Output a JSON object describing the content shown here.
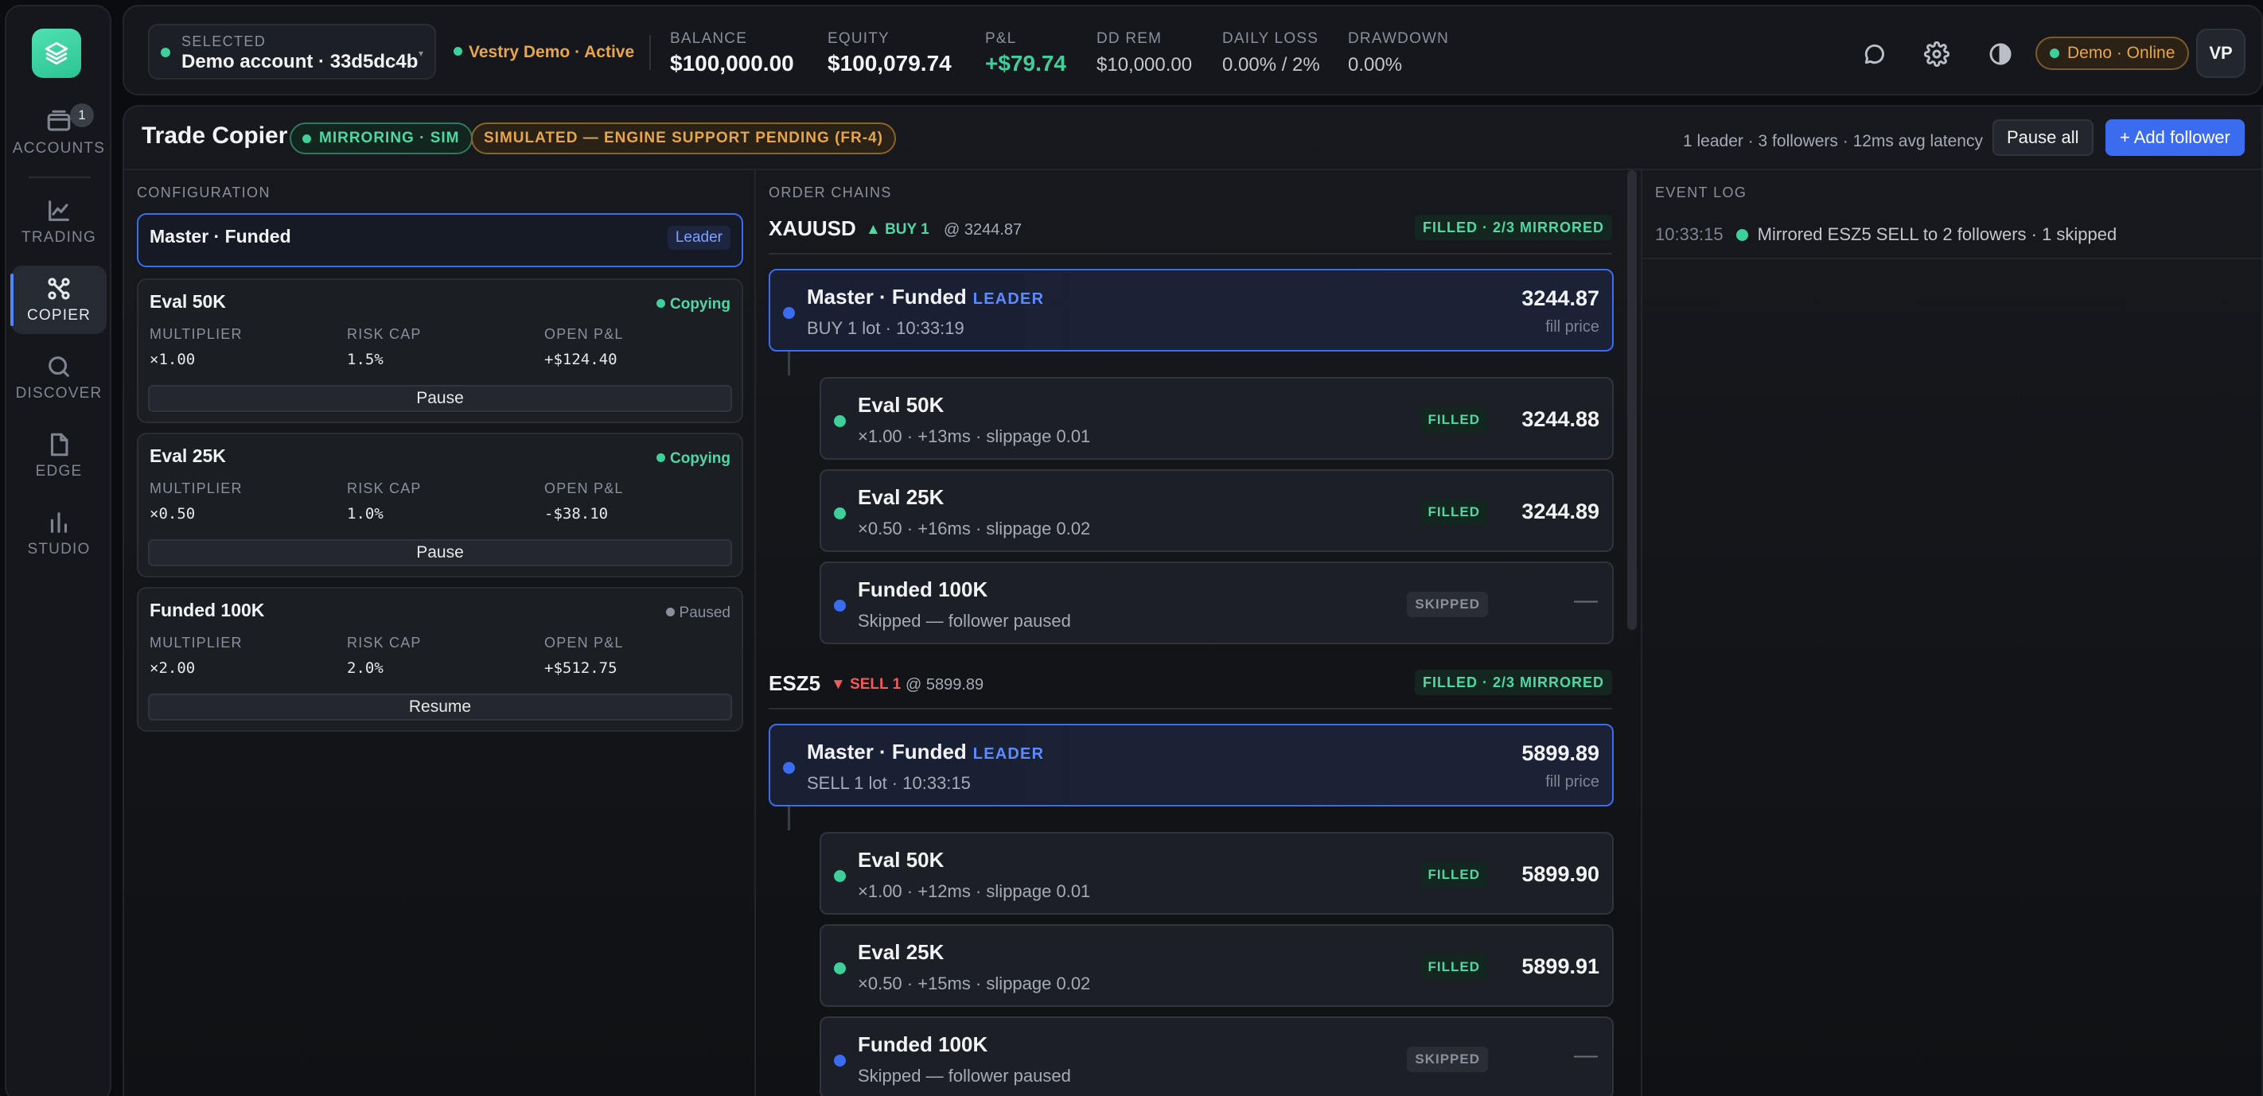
{
  "sidebar": {
    "items": [
      {
        "label": "ACCOUNTS",
        "icon": "wallet-icon",
        "badge": "1"
      },
      {
        "label": "TRADING",
        "icon": "chart-line-icon"
      },
      {
        "label": "COPIER",
        "icon": "copier-share-icon",
        "active": true
      },
      {
        "label": "DISCOVER",
        "icon": "search-icon"
      },
      {
        "label": "EDGE",
        "icon": "document-icon"
      },
      {
        "label": "STUDIO",
        "icon": "bar-chart-icon"
      }
    ]
  },
  "topbar": {
    "selected_label": "SELECTED",
    "account_name": "Demo account · 33d5dc4b",
    "broker_status": "Vestry Demo · Active",
    "stats": [
      {
        "label": "BALANCE",
        "value": "$100,000.00"
      },
      {
        "label": "EQUITY",
        "value": "$100,079.74"
      },
      {
        "label": "P&L",
        "value": "+$79.74"
      },
      {
        "label": "DD REM",
        "value": "$10,000.00"
      },
      {
        "label": "DAILY LOSS",
        "value": "0.00% / 2%"
      },
      {
        "label": "DRAWDOWN",
        "value": "0.00%"
      }
    ],
    "online_label": "Demo · Online",
    "avatar_initials": "VP"
  },
  "page": {
    "title": "Trade Copier",
    "mirroring_pill": "MIRRORING · SIM",
    "simulated_pill": "SIMULATED — ENGINE SUPPORT PENDING (FR-4)",
    "summary": "1 leader · 3 followers · 12ms avg latency",
    "pause_all": "Pause all",
    "add_follower": "+ Add follower"
  },
  "configuration": {
    "label": "CONFIGURATION",
    "leader": {
      "name": "Master · Funded",
      "tag": "Leader"
    },
    "metric_labels": {
      "multiplier": "MULTIPLIER",
      "risk_cap": "RISK CAP",
      "open_pnl": "OPEN P&L"
    },
    "followers": [
      {
        "name": "Eval 50K",
        "status": "Copying",
        "multiplier": "×1.00",
        "risk_cap": "1.5%",
        "open_pnl": "+$124.40",
        "action": "Pause"
      },
      {
        "name": "Eval 25K",
        "status": "Copying",
        "multiplier": "×0.50",
        "risk_cap": "1.0%",
        "open_pnl": "-$38.10",
        "action": "Pause"
      },
      {
        "name": "Funded 100K",
        "status": "Paused",
        "multiplier": "×2.00",
        "risk_cap": "2.0%",
        "open_pnl": "+$512.75",
        "action": "Resume"
      }
    ]
  },
  "order_chains": {
    "label": "ORDER CHAINS",
    "leader_word": "LEADER",
    "fill_price_label": "fill price",
    "chains": [
      {
        "symbol": "XAUUSD",
        "side": "▲ BUY 1",
        "at": "@ 3244.87",
        "status": "FILLED · 2/3 MIRRORED",
        "leader": {
          "name": "Master · Funded",
          "sub": "BUY 1 lot · 10:33:19",
          "price": "3244.87"
        },
        "followers": [
          {
            "name": "Eval 50K",
            "sub": "×1.00 · +13ms · slippage 0.01",
            "state": "FILLED",
            "price": "3244.88"
          },
          {
            "name": "Eval 25K",
            "sub": "×0.50 · +16ms · slippage 0.02",
            "state": "FILLED",
            "price": "3244.89"
          },
          {
            "name": "Funded 100K",
            "sub": "Skipped — follower paused",
            "state": "SKIPPED",
            "price": "—"
          }
        ]
      },
      {
        "symbol": "ESZ5",
        "side": "▼ SELL 1",
        "at": "@ 5899.89",
        "status": "FILLED · 2/3 MIRRORED",
        "leader": {
          "name": "Master · Funded",
          "sub": "SELL 1 lot · 10:33:15",
          "price": "5899.89"
        },
        "followers": [
          {
            "name": "Eval 50K",
            "sub": "×1.00 · +12ms · slippage 0.01",
            "state": "FILLED",
            "price": "5899.90"
          },
          {
            "name": "Eval 25K",
            "sub": "×0.50 · +15ms · slippage 0.02",
            "state": "FILLED",
            "price": "5899.91"
          },
          {
            "name": "Funded 100K",
            "sub": "Skipped — follower paused",
            "state": "SKIPPED",
            "price": "—"
          }
        ]
      }
    ]
  },
  "event_log": {
    "label": "EVENT LOG",
    "entries": [
      {
        "time": "10:33:15",
        "text": "Mirrored ESZ5 SELL to 2 followers · 1 skipped"
      }
    ]
  },
  "colors": {
    "accent_blue": "#3b6cf0",
    "green": "#3ecf9a",
    "amber": "#e7a64a",
    "red": "#ef5a5a"
  }
}
